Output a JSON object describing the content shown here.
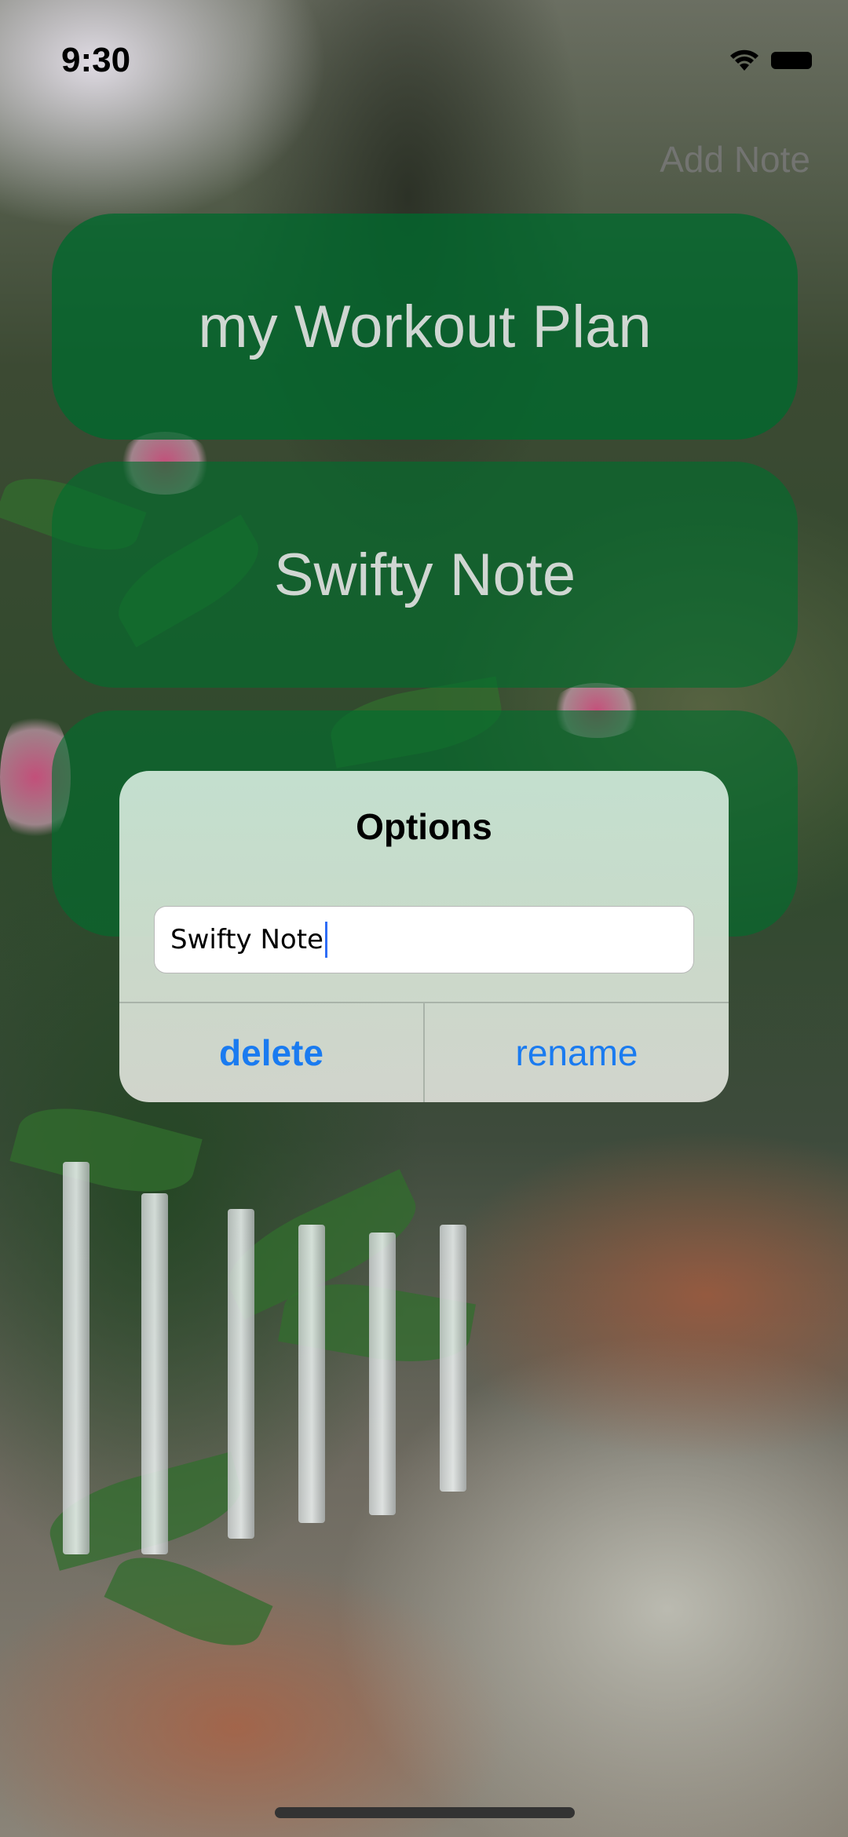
{
  "status_bar": {
    "time": "9:30"
  },
  "header": {
    "add_note_label": "Add Note"
  },
  "notes": [
    {
      "title": "my Workout Plan"
    },
    {
      "title": "Swifty Note"
    },
    {
      "title": ""
    }
  ],
  "dialog": {
    "title": "Options",
    "input_value": "Swifty Note",
    "delete_label": "delete",
    "rename_label": "rename"
  },
  "colors": {
    "card_green": "#006e2d",
    "action_blue": "#1a7bf0"
  },
  "icons": [
    "wifi-icon",
    "battery-icon"
  ]
}
